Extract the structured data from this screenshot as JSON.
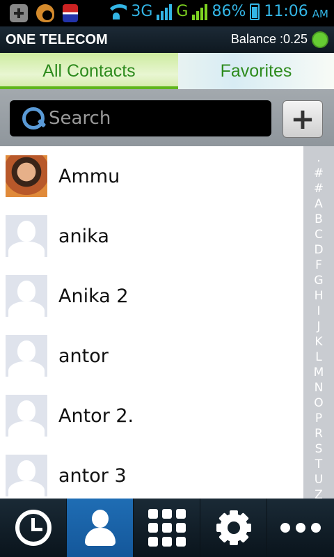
{
  "status_bar": {
    "network": "3G",
    "network2": "G",
    "battery": "86%",
    "time": "11:06",
    "ampm": "AM"
  },
  "header": {
    "brand": "ONE TELECOM",
    "balance": "Balance :0.25"
  },
  "tabs": [
    {
      "label": "All Contacts",
      "active": true
    },
    {
      "label": "Favorites",
      "active": false
    }
  ],
  "search": {
    "placeholder": "Search",
    "add_label": "+"
  },
  "contacts": [
    {
      "name": "Ammu",
      "has_photo": true
    },
    {
      "name": "anika",
      "has_photo": false
    },
    {
      "name": "Anika 2",
      "has_photo": false
    },
    {
      "name": "antor",
      "has_photo": false
    },
    {
      "name": "Antor 2.",
      "has_photo": false
    },
    {
      "name": "antor 3",
      "has_photo": false
    }
  ],
  "index_letters": [
    ".",
    "#",
    "#",
    "A",
    "B",
    "C",
    "D",
    "F",
    "G",
    "H",
    "I",
    "J",
    "K",
    "L",
    "M",
    "N",
    "O",
    "P",
    "R",
    "S",
    "T",
    "U",
    "Z"
  ],
  "bottom_nav": [
    {
      "icon": "clock-icon",
      "label": "recents"
    },
    {
      "icon": "person-icon",
      "label": "contacts",
      "active": true
    },
    {
      "icon": "dialpad-icon",
      "label": "dialpad"
    },
    {
      "icon": "gear-icon",
      "label": "settings"
    },
    {
      "icon": "more-icon",
      "label": "more"
    }
  ],
  "colors": {
    "accent_green": "#2e8b1e",
    "status_blue": "#33b5e5",
    "active_nav": "#1f6db4",
    "balance_dot": "#66cc33"
  }
}
